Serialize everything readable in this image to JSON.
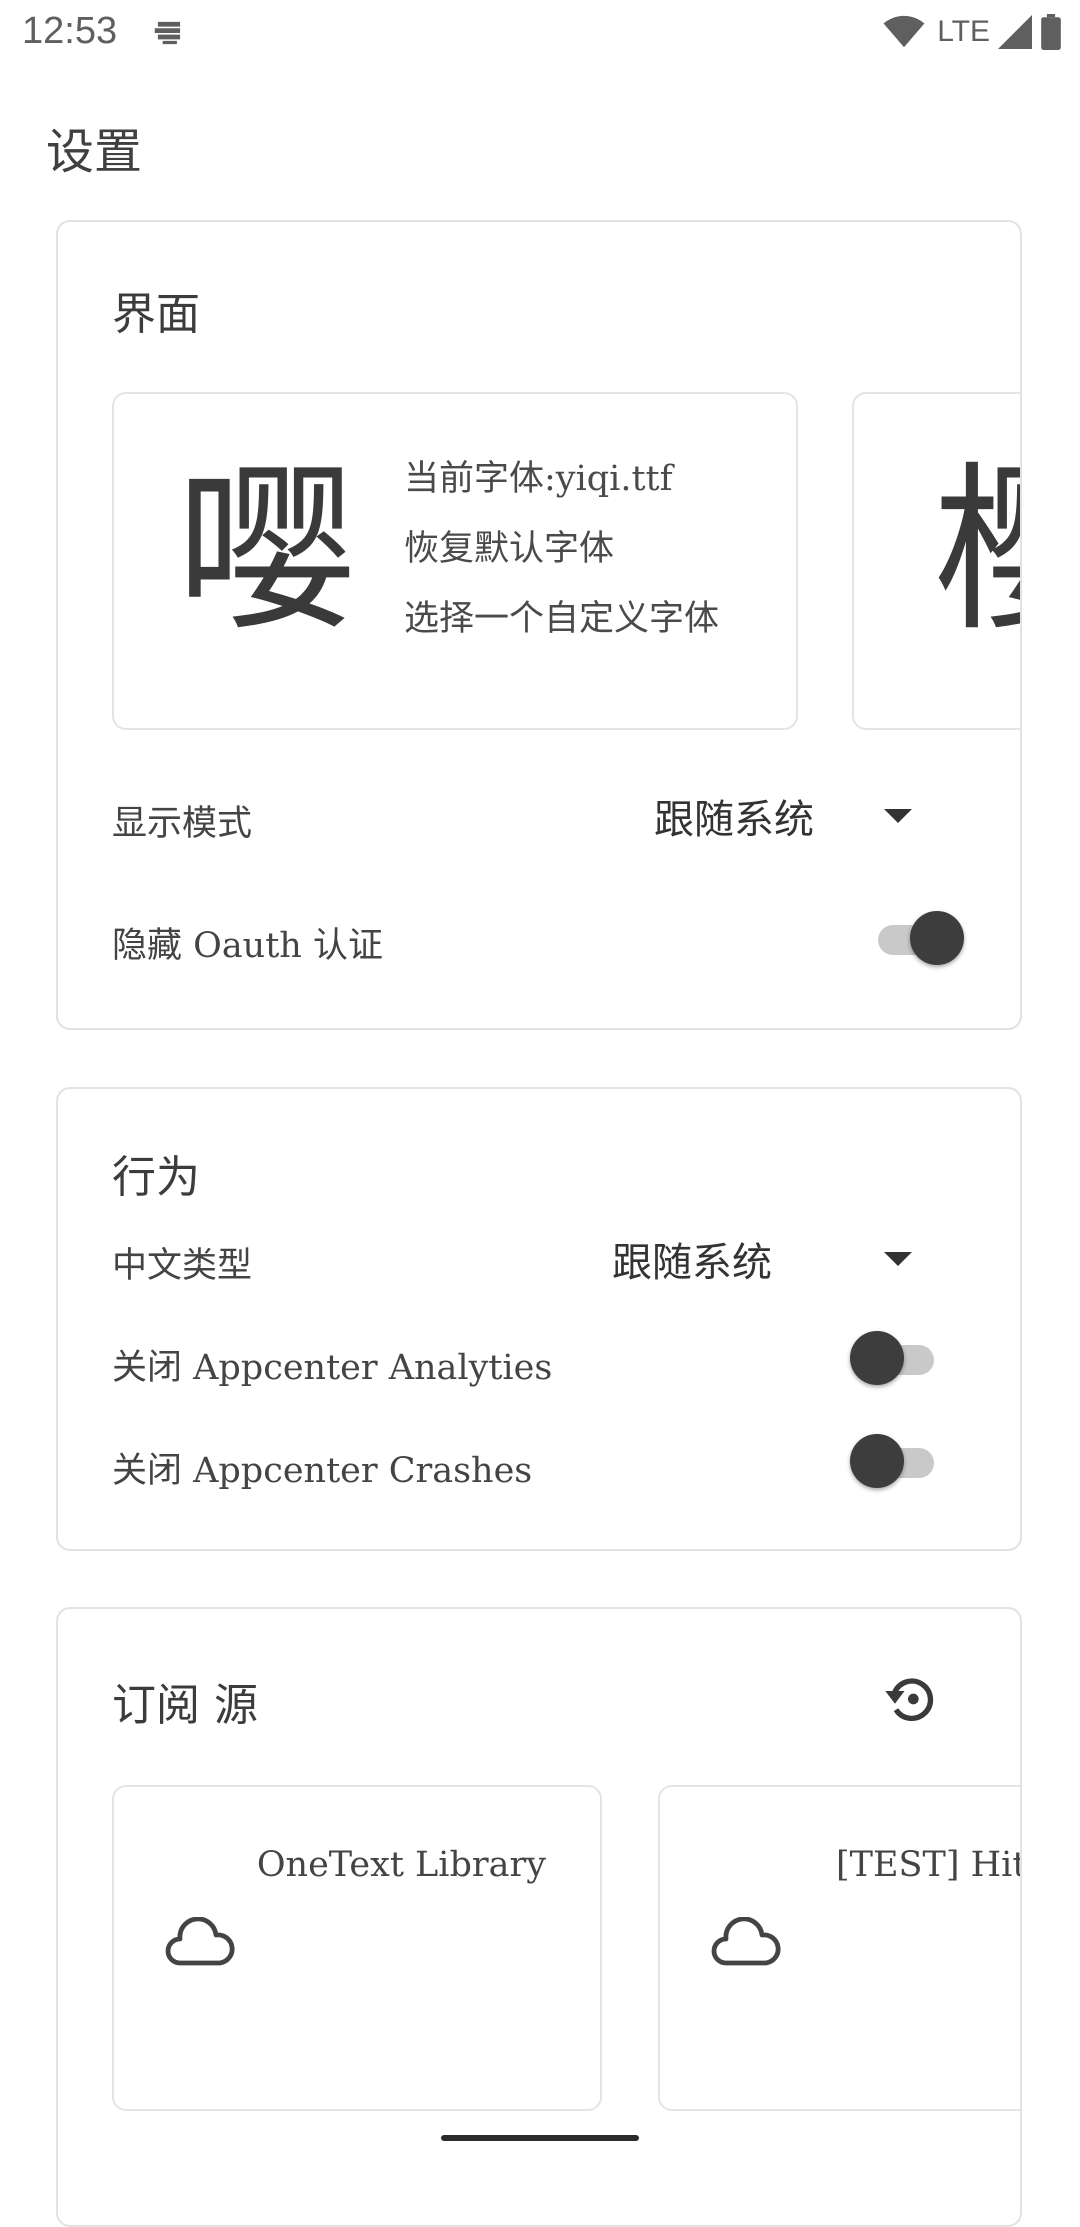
{
  "status_bar": {
    "time": "12:53",
    "network": "LTE",
    "icons": [
      "notification-icon",
      "wifi-icon",
      "signal-icon",
      "battery-icon"
    ]
  },
  "page": {
    "title": "设置"
  },
  "interface_section": {
    "title": "界面",
    "font_tiles": [
      {
        "glyph": "嘤",
        "current_font": "当前字体:yiqi.ttf",
        "restore_default": "恢复默认字体",
        "choose_custom": "选择一个自定义字体"
      },
      {
        "glyph": "樱"
      }
    ],
    "display_mode": {
      "label": "显示模式",
      "value": "跟随系统"
    },
    "hide_oauth": {
      "label": "隐藏 Oauth 认证",
      "on": true
    }
  },
  "behavior_section": {
    "title": "行为",
    "chinese_type": {
      "label": "中文类型",
      "value": "跟随系统"
    },
    "disable_analytics": {
      "label": "关闭 Appcenter Analyties",
      "on": false
    },
    "disable_crashes": {
      "label": "关闭 Appcenter Crashes",
      "on": false
    }
  },
  "sources_section": {
    "title": "订阅 源",
    "action_icon": "restore-icon",
    "sources": [
      {
        "name": "OneText Library",
        "icon": "cloud-icon"
      },
      {
        "name": "[TEST] Hitokoto",
        "icon": "cloud-icon"
      }
    ]
  },
  "colors": {
    "accent": "#3d3d3d",
    "border": "#e2e2e2",
    "switch_track": "#c9c9c9"
  }
}
